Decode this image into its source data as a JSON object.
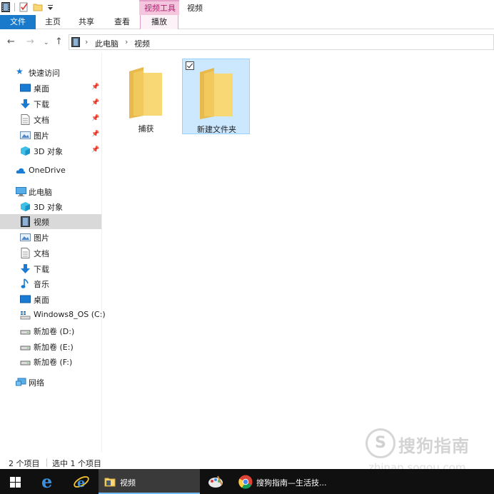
{
  "window": {
    "title": "视频",
    "context_group": "视频工具"
  },
  "ribbon": {
    "tabs": {
      "file": "文件",
      "home": "主页",
      "share": "共享",
      "view": "查看",
      "play": "播放"
    }
  },
  "address": {
    "crumbs": [
      "此电脑",
      "视频"
    ]
  },
  "nav": {
    "quick_access": "快速访问",
    "quick_items": [
      "桌面",
      "下载",
      "文档",
      "图片",
      "3D 对象"
    ],
    "onedrive": "OneDrive",
    "this_pc": "此电脑",
    "pc_items": [
      "3D 对象",
      "视频",
      "图片",
      "文档",
      "下载",
      "音乐",
      "桌面",
      "Windows8_OS (C:)",
      "新加卷 (D:)",
      "新加卷 (E:)",
      "新加卷 (F:)"
    ],
    "network": "网络",
    "selected": "视频"
  },
  "files": [
    {
      "name": "捕获",
      "selected": false
    },
    {
      "name": "新建文件夹",
      "selected": true
    }
  ],
  "status": {
    "count": "2 个项目",
    "selection": "选中 1 个项目"
  },
  "watermark": {
    "logo": "S",
    "title": "搜狗指南",
    "url": "zhinan.sogou.com"
  },
  "taskbar": {
    "explorer_label": "视频",
    "chrome_label": "搜狗指南—生活技..."
  },
  "colors": {
    "file_tab": "#1979ca",
    "selection_fill": "#cce8ff",
    "selection_border": "#99d1ff",
    "context_tab": "#f3c6de",
    "taskbar": "#101010",
    "folder": "#f8d775"
  }
}
